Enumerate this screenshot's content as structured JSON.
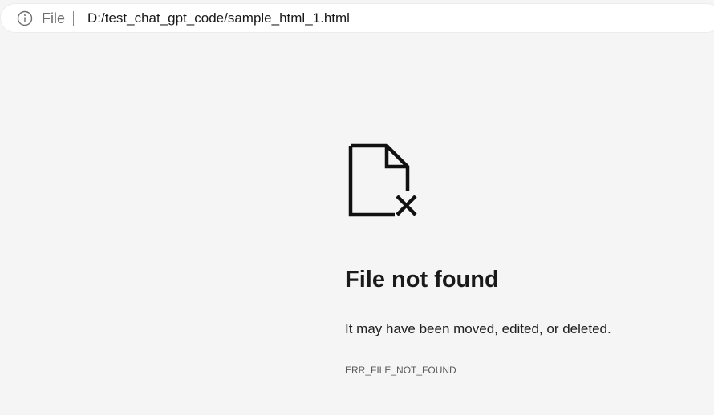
{
  "address_bar": {
    "info_icon": "info-icon",
    "scheme": "File",
    "url": "D:/test_chat_gpt_code/sample_html_1.html"
  },
  "error": {
    "icon": "file-not-found-icon",
    "title": "File not found",
    "message": "It may have been moved, edited, or deleted.",
    "code": "ERR_FILE_NOT_FOUND"
  },
  "colors": {
    "page_background": "#f5f5f5",
    "address_bar_background": "#ffffff",
    "text_primary": "#1a1a1a",
    "text_secondary": "#6e6e6e"
  }
}
